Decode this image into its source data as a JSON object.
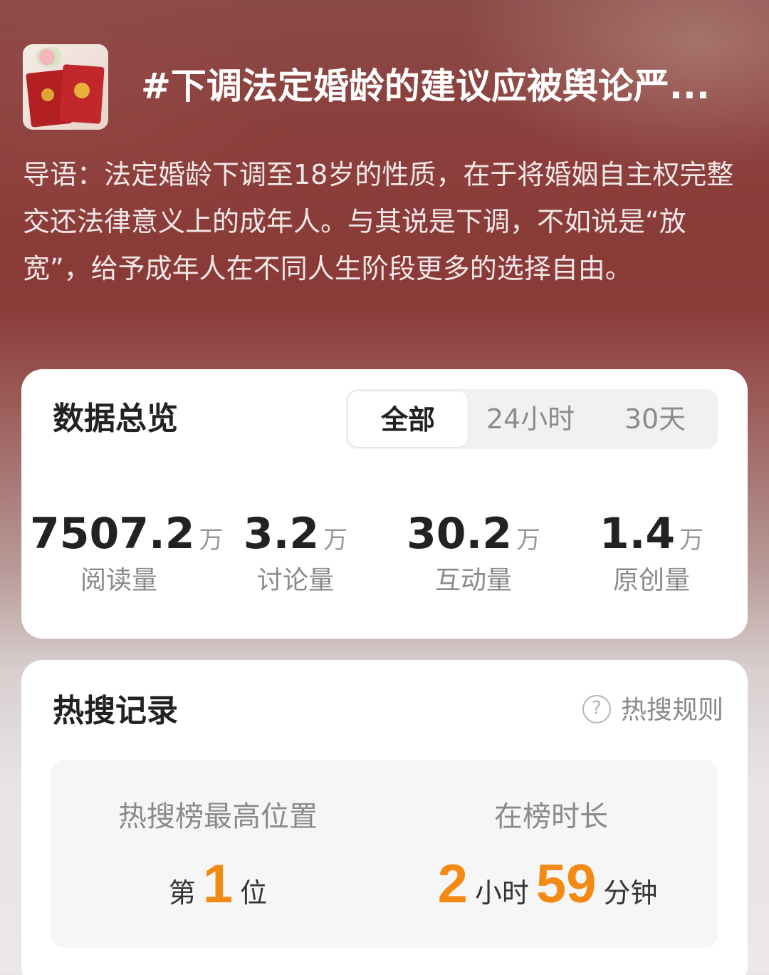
{
  "topic": {
    "title": "#下调法定婚龄的建议应被舆论严...",
    "lead": "导语：法定婚龄下调至18岁的性质，在于将婚姻自主权完整交还法律意义上的成年人。与其说是下调，不如说是“放宽”，给予成年人在不同人生阶段更多的选择自由。"
  },
  "overview": {
    "title": "数据总览",
    "tabs": [
      {
        "label": "全部",
        "active": true
      },
      {
        "label": "24小时",
        "active": false
      },
      {
        "label": "30天",
        "active": false
      }
    ],
    "stats": [
      {
        "value": "7507.2",
        "unit": "万",
        "label": "阅读量"
      },
      {
        "value": "3.2",
        "unit": "万",
        "label": "讨论量"
      },
      {
        "value": "30.2",
        "unit": "万",
        "label": "互动量"
      },
      {
        "value": "1.4",
        "unit": "万",
        "label": "原创量"
      }
    ]
  },
  "hot_search": {
    "title": "热搜记录",
    "rules_link": "热搜规则",
    "help_icon": "question-circle-icon",
    "peak_position": {
      "label": "热搜榜最高位置",
      "prefix": "第",
      "value": "1",
      "suffix": "位"
    },
    "duration": {
      "label": "在榜时长",
      "hours": "2",
      "hours_unit": "小时",
      "minutes": "59",
      "minutes_unit": "分钟"
    }
  },
  "colors": {
    "accent_orange": "#f28a14",
    "header_bg": "#8b3f3c",
    "card_bg": "#ffffff"
  }
}
